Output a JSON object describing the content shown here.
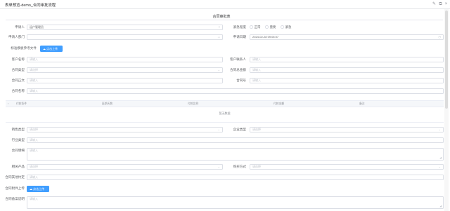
{
  "window": {
    "title": "表单预览-demo_合同审批流程"
  },
  "section": {
    "title": "合同审批表"
  },
  "fields": {
    "applicant_label": "申请人",
    "applicant_value": "运户管理员",
    "urgency_label": "紧急程度",
    "urgency_options": [
      "正常",
      "重要",
      "紧急"
    ],
    "dept_label": "申请人部门",
    "date_label": "申请日期",
    "date_value": "2024-02-28 09:06:07",
    "template_label": "标准模板参考文件",
    "upload_label": "点击上传",
    "customer_name_label": "客户名称",
    "customer_contact_label": "客户联系人",
    "contract_type_label": "合同类型",
    "contract_amount_label": "合同总金额",
    "contract_body_label": "合同正文",
    "contract_no_label": "合同号",
    "contract_name_label": "合同名称",
    "sales_type_label": "销售类型",
    "company_type_label": "企业类型",
    "industry_label": "行业类型",
    "contract_desc_label": "合同明细",
    "product_label": "相关产品",
    "purchase_label": "购买方式",
    "other_label": "合同其他约定",
    "attachment_label": "合同附件上传",
    "notes_label": "合同备案说明",
    "placeholder_input": "请输入",
    "placeholder_select": "请选择"
  },
  "payment_table": {
    "headers": [
      "付款条件",
      "延期天数",
      "付款比例",
      "付款金额",
      "备注"
    ],
    "empty_text": "暂无数据"
  },
  "icons": {
    "edit": "edit-icon",
    "restore": "restore-icon",
    "close": "close-icon",
    "upload": "cloud-upload-icon",
    "calendar": "calendar-icon",
    "chevron": "chevron-down-icon",
    "expand": "expand-icon",
    "dept_picker": "dept-picker-icon"
  },
  "colors": {
    "primary": "#409eff",
    "border": "#dcdfe6",
    "label": "#606266",
    "placeholder": "#c0c4cc"
  }
}
